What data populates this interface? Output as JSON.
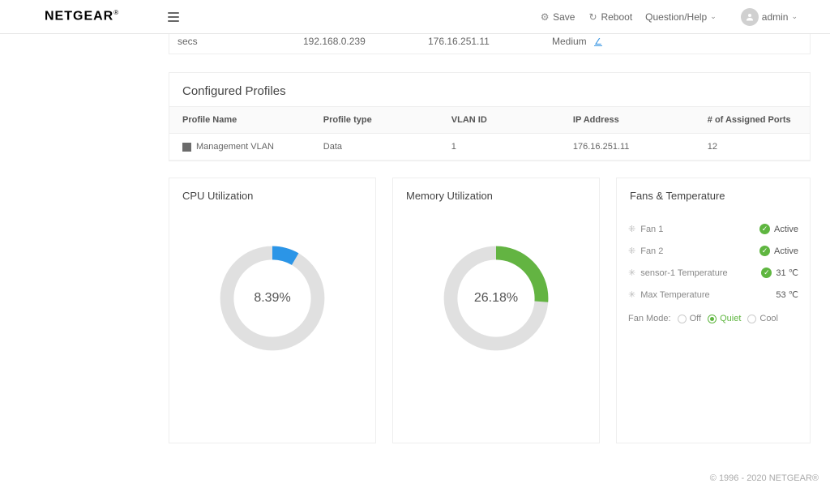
{
  "header": {
    "logo": "NETGEAR",
    "save_label": "Save",
    "reboot_label": "Reboot",
    "help_label": "Question/Help",
    "username": "admin"
  },
  "info": {
    "uptime": "secs",
    "ip1": "192.168.0.239",
    "ip2": "176.16.251.11",
    "level": "Medium"
  },
  "profiles": {
    "title": "Configured Profiles",
    "columns": {
      "name": "Profile Name",
      "type": "Profile type",
      "vlan": "VLAN ID",
      "ip": "IP Address",
      "ports": "# of Assigned Ports"
    },
    "rows": [
      {
        "name": "Management VLAN",
        "type": "Data",
        "vlan": "1",
        "ip": "176.16.251.11",
        "ports": "12"
      }
    ]
  },
  "cpu": {
    "title": "CPU Utilization",
    "percent": 8.39,
    "display": "8.39%"
  },
  "memory": {
    "title": "Memory Utilization",
    "percent": 26.18,
    "display": "26.18%"
  },
  "fans": {
    "title": "Fans & Temperature",
    "items": [
      {
        "label": "Fan 1",
        "status": "Active",
        "icon": "fan"
      },
      {
        "label": "Fan 2",
        "status": "Active",
        "icon": "fan"
      },
      {
        "label": "sensor-1 Temperature",
        "status": "31 ℃",
        "icon": "temp",
        "badge": true
      },
      {
        "label": "Max Temperature",
        "status": "53 ℃",
        "icon": "temp",
        "badge": false
      }
    ],
    "mode_label": "Fan Mode:",
    "modes": {
      "off": "Off",
      "quiet": "Quiet",
      "cool": "Cool"
    }
  },
  "chart_data": [
    {
      "type": "pie",
      "title": "CPU Utilization",
      "slices": [
        {
          "name": "used",
          "value": 8.39
        },
        {
          "name": "free",
          "value": 91.61
        }
      ],
      "display": "8.39%"
    },
    {
      "type": "pie",
      "title": "Memory Utilization",
      "slices": [
        {
          "name": "used",
          "value": 26.18
        },
        {
          "name": "free",
          "value": 73.82
        }
      ],
      "display": "26.18%"
    }
  ],
  "footer": "© 1996 - 2020 NETGEAR®"
}
